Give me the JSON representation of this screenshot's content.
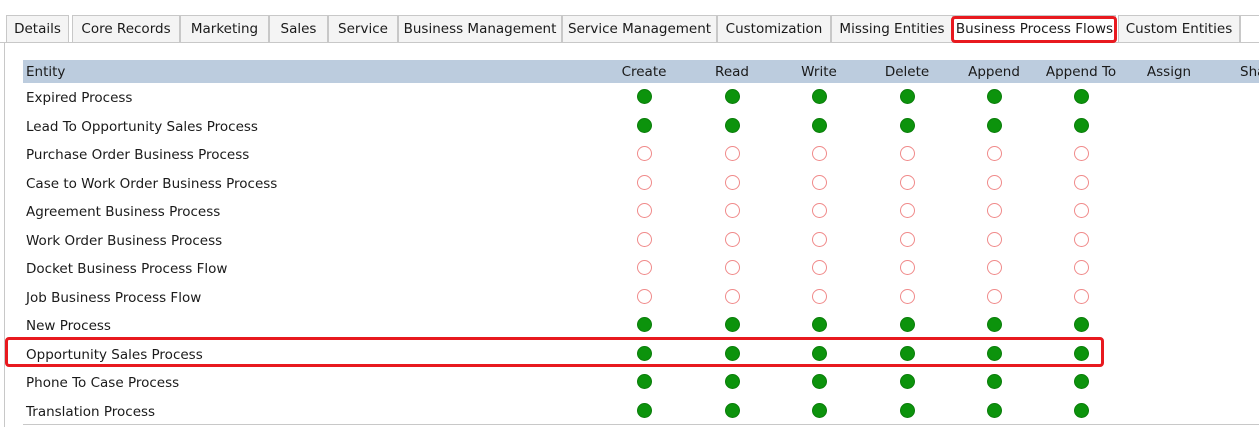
{
  "tabs": [
    {
      "label": "Details",
      "active": false
    },
    {
      "label": "Core Records",
      "active": false
    },
    {
      "label": "Marketing",
      "active": false
    },
    {
      "label": "Sales",
      "active": false
    },
    {
      "label": "Service",
      "active": false
    },
    {
      "label": "Business Management",
      "active": false
    },
    {
      "label": "Service Management",
      "active": false
    },
    {
      "label": "Customization",
      "active": false
    },
    {
      "label": "Missing Entities",
      "active": false
    },
    {
      "label": "Business Process Flows",
      "active": true
    },
    {
      "label": "Custom Entities",
      "active": false
    }
  ],
  "grid": {
    "entity_header": "Entity",
    "columns": [
      "Create",
      "Read",
      "Write",
      "Delete",
      "Append",
      "Append To",
      "Assign",
      "Sha"
    ],
    "rows": [
      {
        "entity": "Expired Process",
        "privileges": [
          true,
          true,
          true,
          true,
          true,
          true
        ]
      },
      {
        "entity": "Lead To Opportunity Sales Process",
        "privileges": [
          true,
          true,
          true,
          true,
          true,
          true
        ]
      },
      {
        "entity": "Purchase Order Business Process",
        "privileges": [
          false,
          false,
          false,
          false,
          false,
          false
        ]
      },
      {
        "entity": "Case to Work Order Business Process",
        "privileges": [
          false,
          false,
          false,
          false,
          false,
          false
        ]
      },
      {
        "entity": "Agreement Business Process",
        "privileges": [
          false,
          false,
          false,
          false,
          false,
          false
        ]
      },
      {
        "entity": "Work Order Business Process",
        "privileges": [
          false,
          false,
          false,
          false,
          false,
          false
        ]
      },
      {
        "entity": "Docket Business Process Flow",
        "privileges": [
          false,
          false,
          false,
          false,
          false,
          false
        ]
      },
      {
        "entity": "Job Business Process Flow",
        "privileges": [
          false,
          false,
          false,
          false,
          false,
          false
        ]
      },
      {
        "entity": "New Process",
        "privileges": [
          true,
          true,
          true,
          true,
          true,
          true
        ]
      },
      {
        "entity": "Opportunity Sales Process",
        "privileges": [
          true,
          true,
          true,
          true,
          true,
          true
        ]
      },
      {
        "entity": "Phone To Case Process",
        "privileges": [
          true,
          true,
          true,
          true,
          true,
          true
        ]
      },
      {
        "entity": "Translation Process",
        "privileges": [
          true,
          true,
          true,
          true,
          true,
          true
        ]
      }
    ]
  },
  "colors": {
    "granted": "#0c930c",
    "not_granted_outline": "#f08a8a",
    "highlight": "#e8191f",
    "header_bg": "#bcccde"
  }
}
